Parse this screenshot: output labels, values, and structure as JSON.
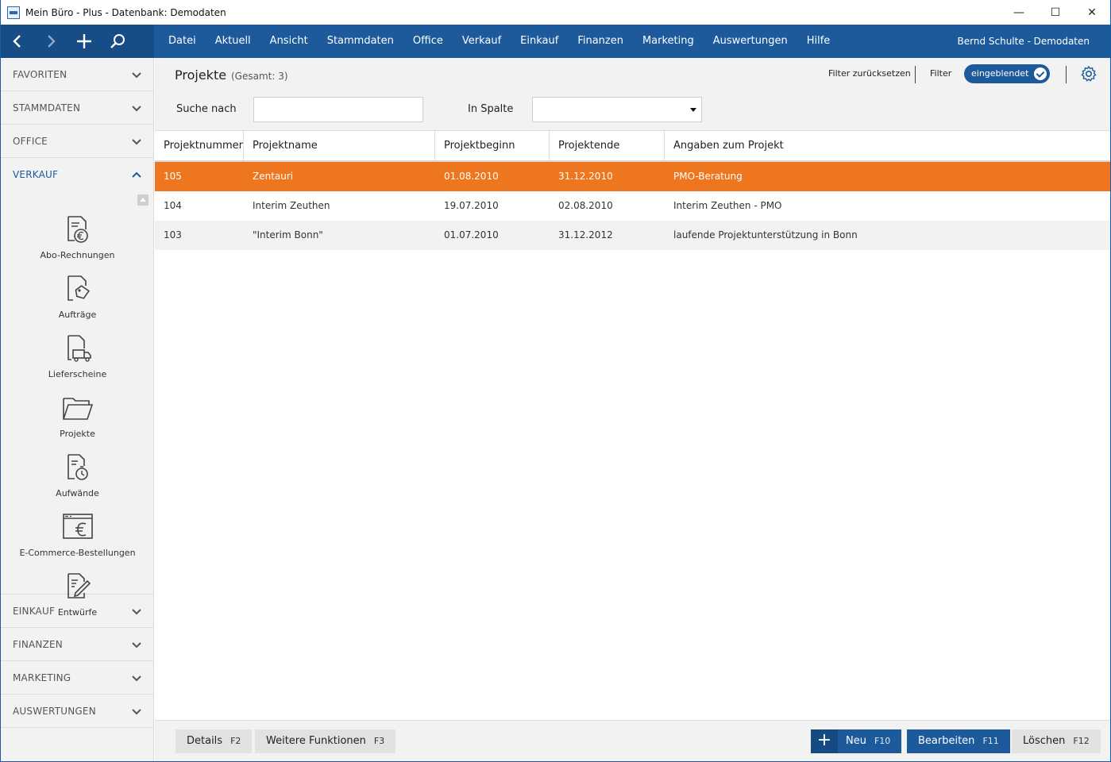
{
  "window": {
    "title": "Mein Büro - Plus - Datenbank: Demodaten",
    "minimize_glyph": "—",
    "maximize_glyph": "☐",
    "close_glyph": "✕"
  },
  "nav": {
    "back_glyph": "‹",
    "forward_glyph": "›",
    "add_glyph": "+",
    "menu": [
      "Datei",
      "Aktuell",
      "Ansicht",
      "Stammdaten",
      "Office",
      "Verkauf",
      "Einkauf",
      "Finanzen",
      "Marketing",
      "Auswertungen",
      "Hilfe"
    ],
    "user": "Bernd Schulte - Demodaten"
  },
  "sidebar": {
    "sections_top": [
      "FAVORITEN",
      "STAMMDATEN",
      "OFFICE"
    ],
    "active_section": "VERKAUF",
    "items": [
      {
        "label": "Abo-Rechnungen",
        "icon": "invoice-euro-icon"
      },
      {
        "label": "Aufträge",
        "icon": "order-tag-icon"
      },
      {
        "label": "Lieferscheine",
        "icon": "delivery-truck-icon"
      },
      {
        "label": "Projekte",
        "icon": "folder-icon"
      },
      {
        "label": "Aufwände",
        "icon": "timer-document-icon"
      },
      {
        "label": "E-Commerce-Bestellungen",
        "icon": "ecommerce-euro-icon"
      },
      {
        "label": "Entwürfe",
        "icon": "draft-pen-icon"
      }
    ],
    "sections_bottom": [
      "EINKAUF",
      "FINANZEN",
      "MARKETING",
      "AUSWERTUNGEN"
    ]
  },
  "header": {
    "title": "Projekte",
    "count": "(Gesamt: 3)",
    "filter_reset": "Filter zurücksetzen",
    "filter_label": "Filter",
    "filter_toggle": "eingeblendet",
    "search_label": "Suche nach",
    "search_value": "",
    "column_label": "In Spalte",
    "column_value": ""
  },
  "table": {
    "columns": [
      "Projektnummer",
      "Projektname",
      "Projektbeginn",
      "Projektende",
      "Angaben zum Projekt"
    ],
    "rows": [
      [
        "105",
        "Zentauri",
        "01.08.2010",
        "31.12.2010",
        "PMO-Beratung"
      ],
      [
        "104",
        "Interim Zeuthen",
        "19.07.2010",
        "02.08.2010",
        "Interim Zeuthen - PMO"
      ],
      [
        "103",
        "\"Interim Bonn\"",
        "01.07.2010",
        "31.12.2012",
        "laufende Projektunterstützung in Bonn"
      ]
    ],
    "selected_row": 0
  },
  "footer": {
    "details": {
      "label": "Details",
      "key": "F2"
    },
    "more": {
      "label": "Weitere Funktionen",
      "key": "F3"
    },
    "new": {
      "label": "Neu",
      "key": "F10"
    },
    "edit": {
      "label": "Bearbeiten",
      "key": "F11"
    },
    "delete": {
      "label": "Löschen",
      "key": "F12"
    }
  },
  "colors": {
    "brand": "#1c5a9c",
    "selection": "#ee761e"
  }
}
